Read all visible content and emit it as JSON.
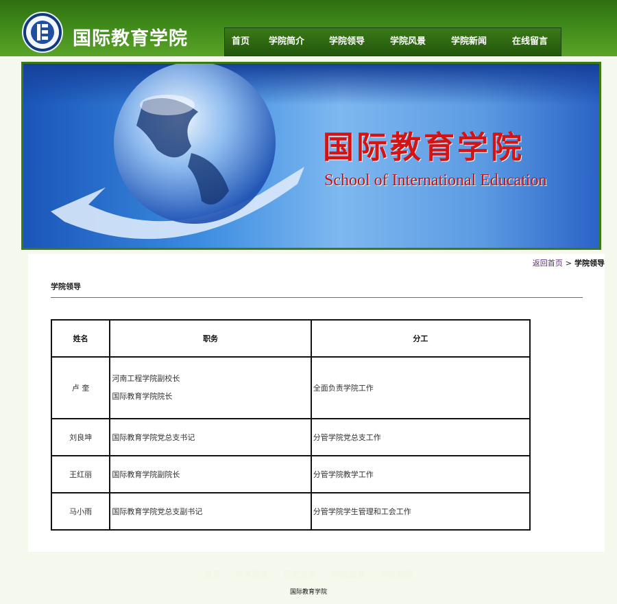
{
  "header": {
    "title": "国际教育学院",
    "logo_icon": "school-emblem-icon"
  },
  "nav": [
    {
      "label": "首页"
    },
    {
      "label": "学院简介"
    },
    {
      "label": "学院领导"
    },
    {
      "label": "学院风景"
    },
    {
      "label": "学院新闻"
    },
    {
      "label": "在线留言"
    }
  ],
  "banner": {
    "title_zh": "国际教育学院",
    "title_en": "School of International Education"
  },
  "breadcrumb": {
    "home": "返回首页",
    "separator": ">",
    "current": "学院领导"
  },
  "section": {
    "title": "学院领导"
  },
  "table": {
    "headers": [
      "姓名",
      "职务",
      "分工"
    ],
    "rows": [
      {
        "name": "卢 奎",
        "post_1": "河南工程学院副校长",
        "post_2": "国际教育学院院长",
        "duty": "全面负责学院工作"
      },
      {
        "name": "刘良坤",
        "post": "国际教育学院党总支书记",
        "duty": "分管学院党总支工作"
      },
      {
        "name": "王红丽",
        "post": "国际教育学院副院长",
        "duty": "分管学院教学工作"
      },
      {
        "name": "马小雨",
        "post": "国际教育学院党总支副书记",
        "duty": "分管学院学生管理和工会工作"
      }
    ]
  },
  "footer": {
    "links": [
      "首页",
      "学术概念",
      "历史沿革",
      "学院故事",
      "学院新闻"
    ],
    "name": "国际教育学院"
  },
  "colors": {
    "header_green": "#3f8a1a",
    "nav_green": "#2d6611",
    "banner_blue": "#3a8be0",
    "banner_text_red": "#d41414",
    "page_bg": "#f5f9ed"
  }
}
